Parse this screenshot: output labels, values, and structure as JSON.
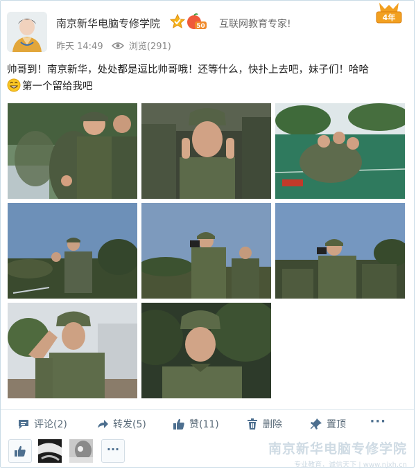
{
  "header": {
    "account_name": "南京新华电脑专修学院",
    "level_badge": "50",
    "tagline": "互联网教育专家!",
    "years_badge": "4年"
  },
  "meta": {
    "time": "昨天 14:49",
    "views": "浏览(291)"
  },
  "post": {
    "line1": "帅哥到！南京新华，处处都是逗比帅哥哦！还等什么，快扑上去吧，妹子们！哈哈",
    "line2": "第一个留给我吧"
  },
  "toolbar": {
    "comment": "评论(2)",
    "repost": "转发(5)",
    "like": "赞(11)",
    "delete": "删除",
    "pin": "置顶",
    "more": "···"
  },
  "likers": {
    "more": "···"
  },
  "watermark": {
    "title": "南京新华电脑专修学院",
    "subtitle": "专业教育，诚信天下 | www.njxh.cn"
  },
  "colors": {
    "link": "#4d6f8f",
    "muted": "#8a8a8a",
    "border": "#c9dbe6",
    "watermark": "#cfdbe4"
  }
}
